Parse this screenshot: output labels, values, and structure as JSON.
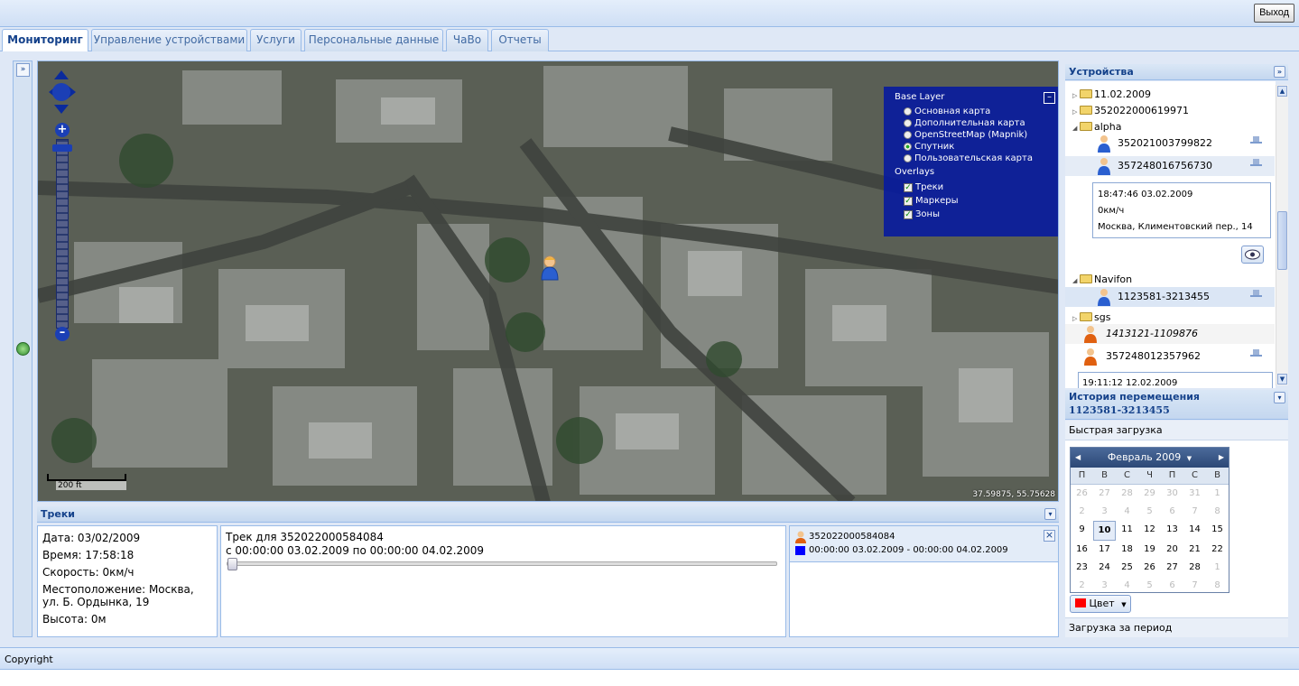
{
  "topbar": {
    "logout_label": "Выход"
  },
  "tabs": [
    {
      "label": "Мониторинг",
      "active": true
    },
    {
      "label": "Управление устройствами"
    },
    {
      "label": "Услуги"
    },
    {
      "label": "Персональные данные"
    },
    {
      "label": "ЧаВо"
    },
    {
      "label": "Отчеты"
    }
  ],
  "map": {
    "layers": {
      "base_title": "Base Layer",
      "base": [
        "Основная карта",
        "Дополнительная карта",
        "OpenStreetMap (Mapnik)",
        "Спутник",
        "Пользовательская карта"
      ],
      "selected_base": "Спутник",
      "overlays_title": "Overlays",
      "overlays": [
        "Треки",
        "Маркеры",
        "Зоны"
      ]
    },
    "coords": "37.59875, 55.75628",
    "scale": "200 ft"
  },
  "tracks": {
    "title": "Треки",
    "info": {
      "date": "Дата: 03/02/2009",
      "time": "Время: 17:58:18",
      "speed": "Скорость: 0км/ч",
      "location": "Местоположение: Москва, ул. Б. Ордынка, 19",
      "altitude": "Высота: 0м"
    },
    "track_title": "Трек для 352022000584084",
    "track_period": "с 00:00:00 03.02.2009 по 00:00:00 04.02.2009",
    "slider_value": 0,
    "legend_device": "352022000584084",
    "legend_period": "00:00:00 03.02.2009 - 00:00:00 04.02.2009",
    "legend_color": "#0000ff"
  },
  "devices": {
    "title": "Устройства",
    "items": [
      {
        "type": "folder",
        "label": "11.02.2009",
        "expanded": false
      },
      {
        "type": "folder",
        "label": "352022000619971",
        "expanded": false
      },
      {
        "type": "folder",
        "label": "alpha",
        "expanded": true
      },
      {
        "type": "device",
        "label": "352021003799822"
      },
      {
        "type": "device",
        "label": "357248016756730"
      },
      {
        "type": "folder",
        "label": "Navifon",
        "expanded": true
      },
      {
        "type": "device",
        "label": "1123581-3213455"
      },
      {
        "type": "folder",
        "label": "sgs",
        "expanded": false
      },
      {
        "type": "device",
        "label": "1413121-1109876"
      },
      {
        "type": "device",
        "label": "357248012357962"
      }
    ],
    "popup": {
      "time": "18:47:46 03.02.2009",
      "speed": "0км/ч",
      "address": "Москва, Климентовский пер., 14"
    },
    "clipped_text": "19:11:12 12.02.2009"
  },
  "history": {
    "title": "История перемещения",
    "device": "1123581-3213455",
    "quick_load": "Быстрая загрузка",
    "calendar": {
      "month_label": "Февраль 2009",
      "weekdays": [
        "П",
        "В",
        "С",
        "Ч",
        "П",
        "С",
        "В"
      ],
      "days": [
        "26",
        "27",
        "28",
        "29",
        "30",
        "31",
        "1",
        "2",
        "3",
        "4",
        "5",
        "6",
        "7",
        "8",
        "9",
        "10",
        "11",
        "12",
        "13",
        "14",
        "15",
        "16",
        "17",
        "18",
        "19",
        "20",
        "21",
        "22",
        "23",
        "24",
        "25",
        "26",
        "27",
        "28",
        "1",
        "2",
        "3",
        "4",
        "5",
        "6",
        "7",
        "8"
      ],
      "selected": "10"
    },
    "color_label": "Цвет",
    "color_value": "#ff0000",
    "period_load": "Загрузка за период"
  },
  "footer": {
    "copyright": "Copyright"
  }
}
